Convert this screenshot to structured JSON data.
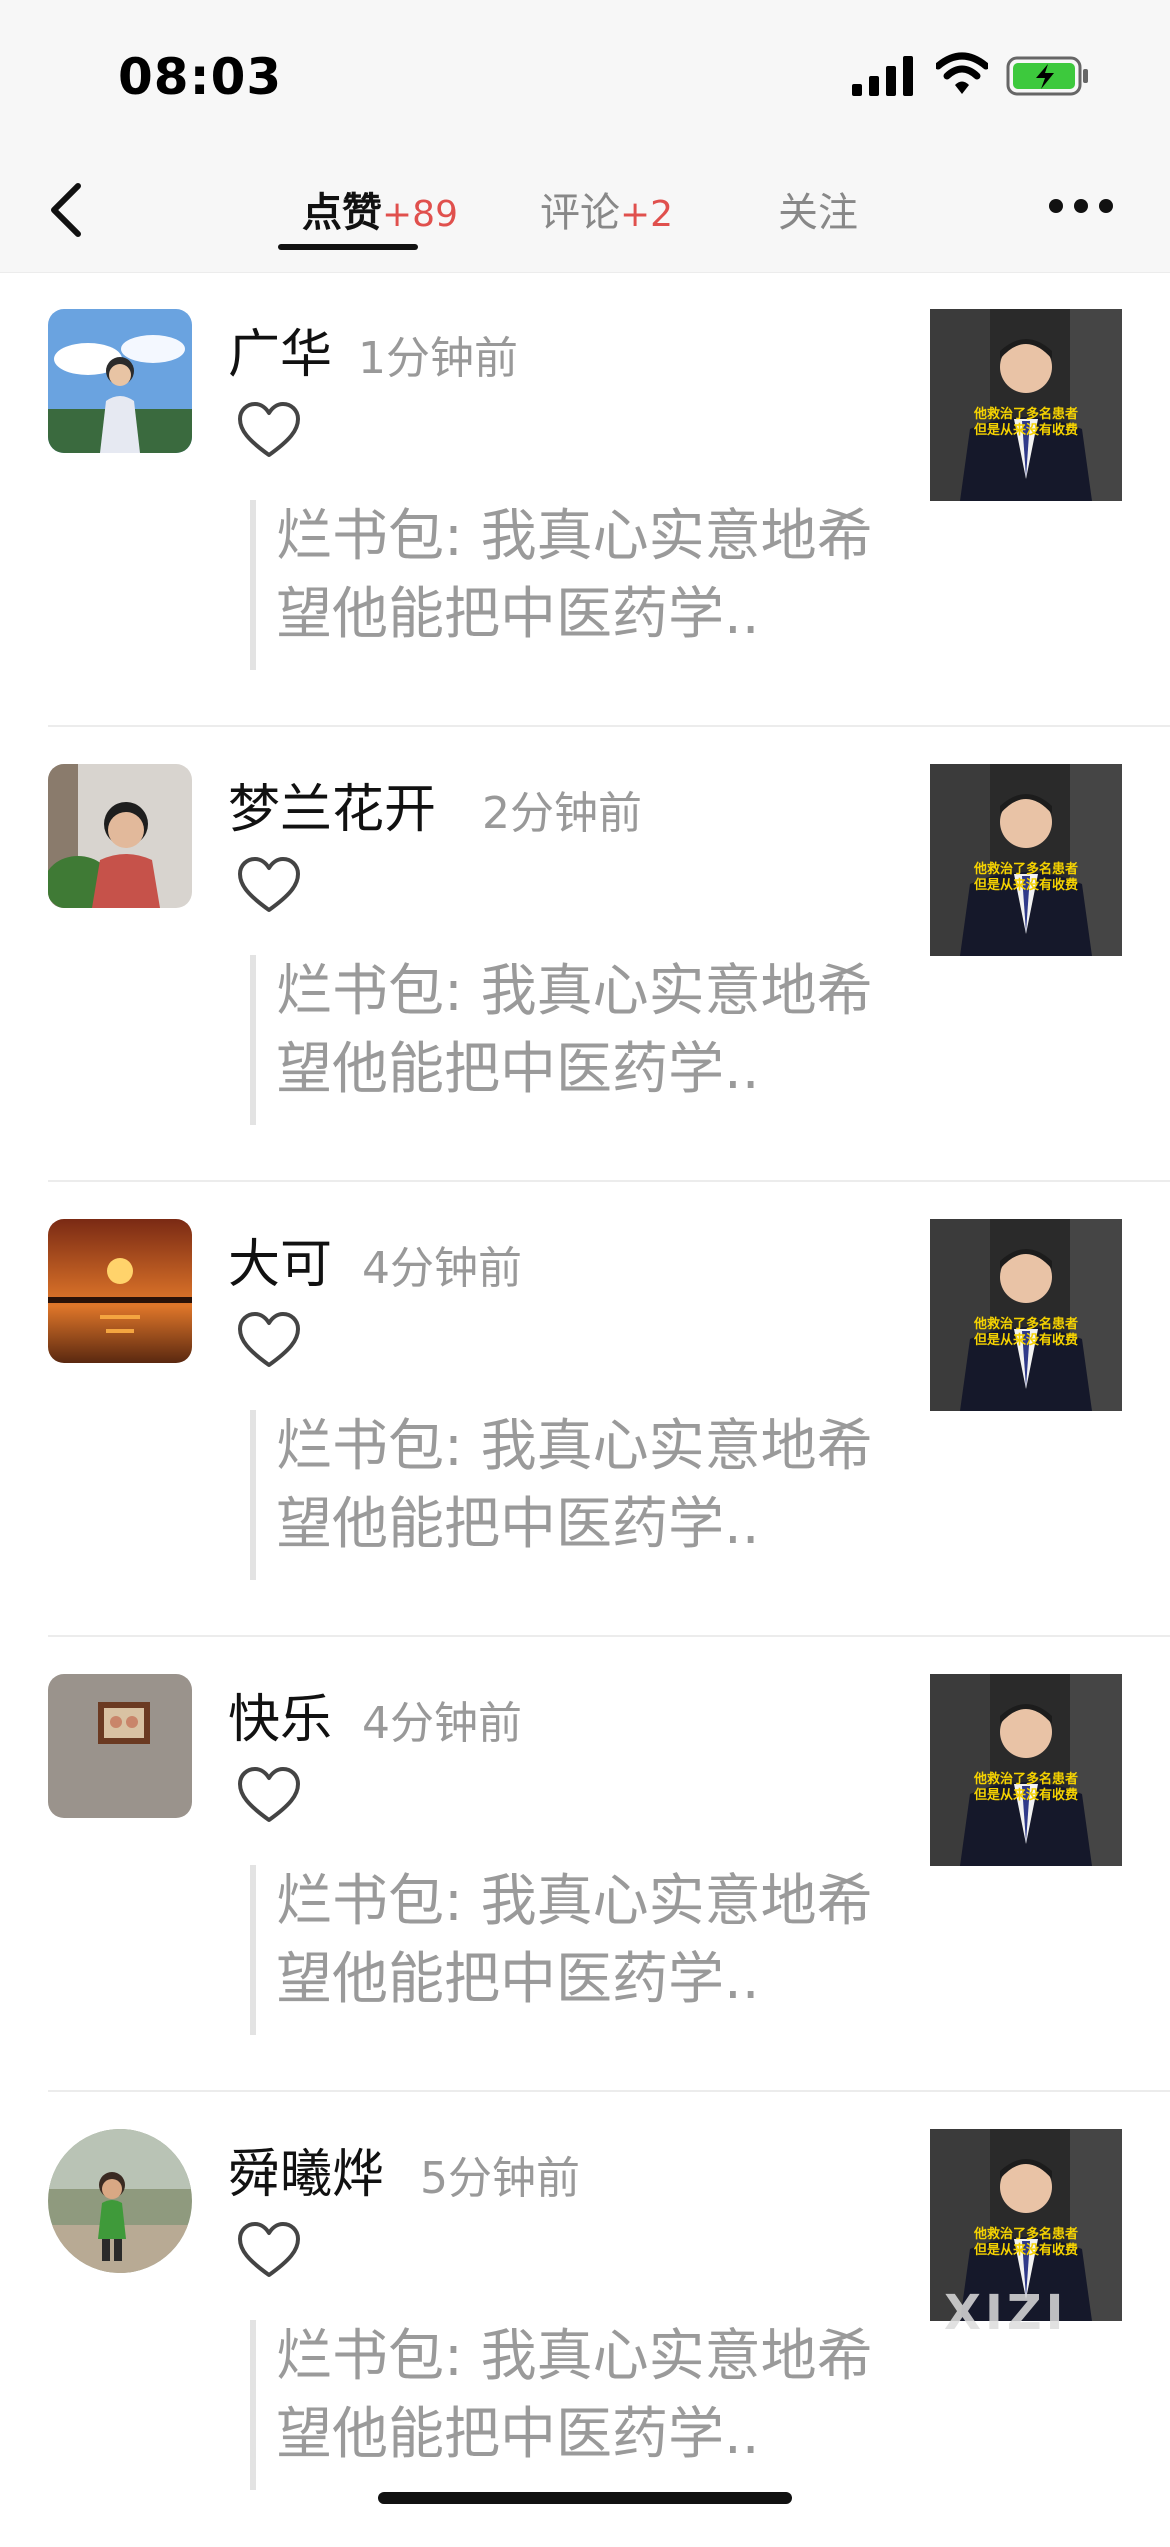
{
  "status_bar": {
    "time": "08:03"
  },
  "nav": {
    "tabs": [
      {
        "label": "点赞",
        "count": "+89",
        "active": true
      },
      {
        "label": "评论",
        "count": "+2",
        "active": false
      },
      {
        "label": "关注",
        "count": "",
        "active": false
      }
    ]
  },
  "items": [
    {
      "name": "广华",
      "time": "1分钟前",
      "quote": "烂书包: 我真心实意地希望他能把中医药学.."
    },
    {
      "name": "梦兰花开",
      "time": "2分钟前",
      "quote": "烂书包: 我真心实意地希望他能把中医药学.."
    },
    {
      "name": "大可",
      "time": "4分钟前",
      "quote": "烂书包: 我真心实意地希望他能把中医药学.."
    },
    {
      "name": "快乐",
      "time": "4分钟前",
      "quote": "烂书包: 我真心实意地希望他能把中医药学.."
    },
    {
      "name": "舜曦烨",
      "time": "5分钟前",
      "quote": "烂书包: 我真心实意地希望他能把中医药学.."
    }
  ],
  "thumbnail": {
    "caption_line1": "他救治了多名患者",
    "caption_line2": "但是从来没有收费"
  },
  "watermark": "XIZI",
  "colors": {
    "accent_count": "#e0504d",
    "secondary_text": "#999999",
    "quote_bar": "#e3e3e3"
  }
}
